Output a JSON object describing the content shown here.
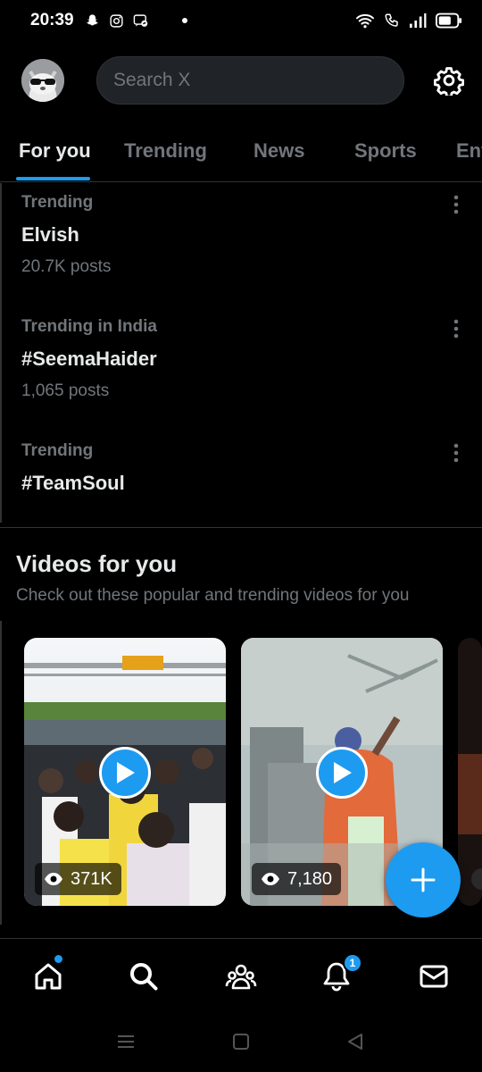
{
  "status_bar": {
    "time": "20:39",
    "left_icons": [
      "snapchat-icon",
      "instagram-icon",
      "messenger-icon"
    ],
    "right_icons": [
      "wifi-icon",
      "call-icon",
      "signal-icon",
      "battery-icon"
    ]
  },
  "header": {
    "search_placeholder": "Search X",
    "avatar_icon": "avatar",
    "settings_icon": "gear-icon"
  },
  "tabs": [
    {
      "label": "For you",
      "active": true
    },
    {
      "label": "Trending",
      "active": false
    },
    {
      "label": "News",
      "active": false
    },
    {
      "label": "Sports",
      "active": false
    },
    {
      "label": "Ent",
      "active": false
    }
  ],
  "trends": [
    {
      "context": "Trending",
      "name": "Elvish",
      "posts": "20.7K posts"
    },
    {
      "context": "Trending in India",
      "name": "#SeemaHaider",
      "posts": "1,065 posts"
    },
    {
      "context": "Trending",
      "name": "#TeamSoul",
      "posts": ""
    }
  ],
  "videos": {
    "title": "Videos for you",
    "subtitle": "Check out these popular and trending videos for you",
    "items": [
      {
        "views": "371K"
      },
      {
        "views": "7,180"
      }
    ]
  },
  "fab_icon": "plus-icon",
  "bottom_nav": {
    "items": [
      "home-icon",
      "search-icon",
      "communities-icon",
      "notifications-icon",
      "messages-icon"
    ],
    "notification_count": "1"
  },
  "colors": {
    "accent": "#1d9bf0",
    "background": "#000000",
    "text_primary": "#e7e9ea",
    "text_secondary": "#71767b",
    "border": "#2f3336"
  }
}
